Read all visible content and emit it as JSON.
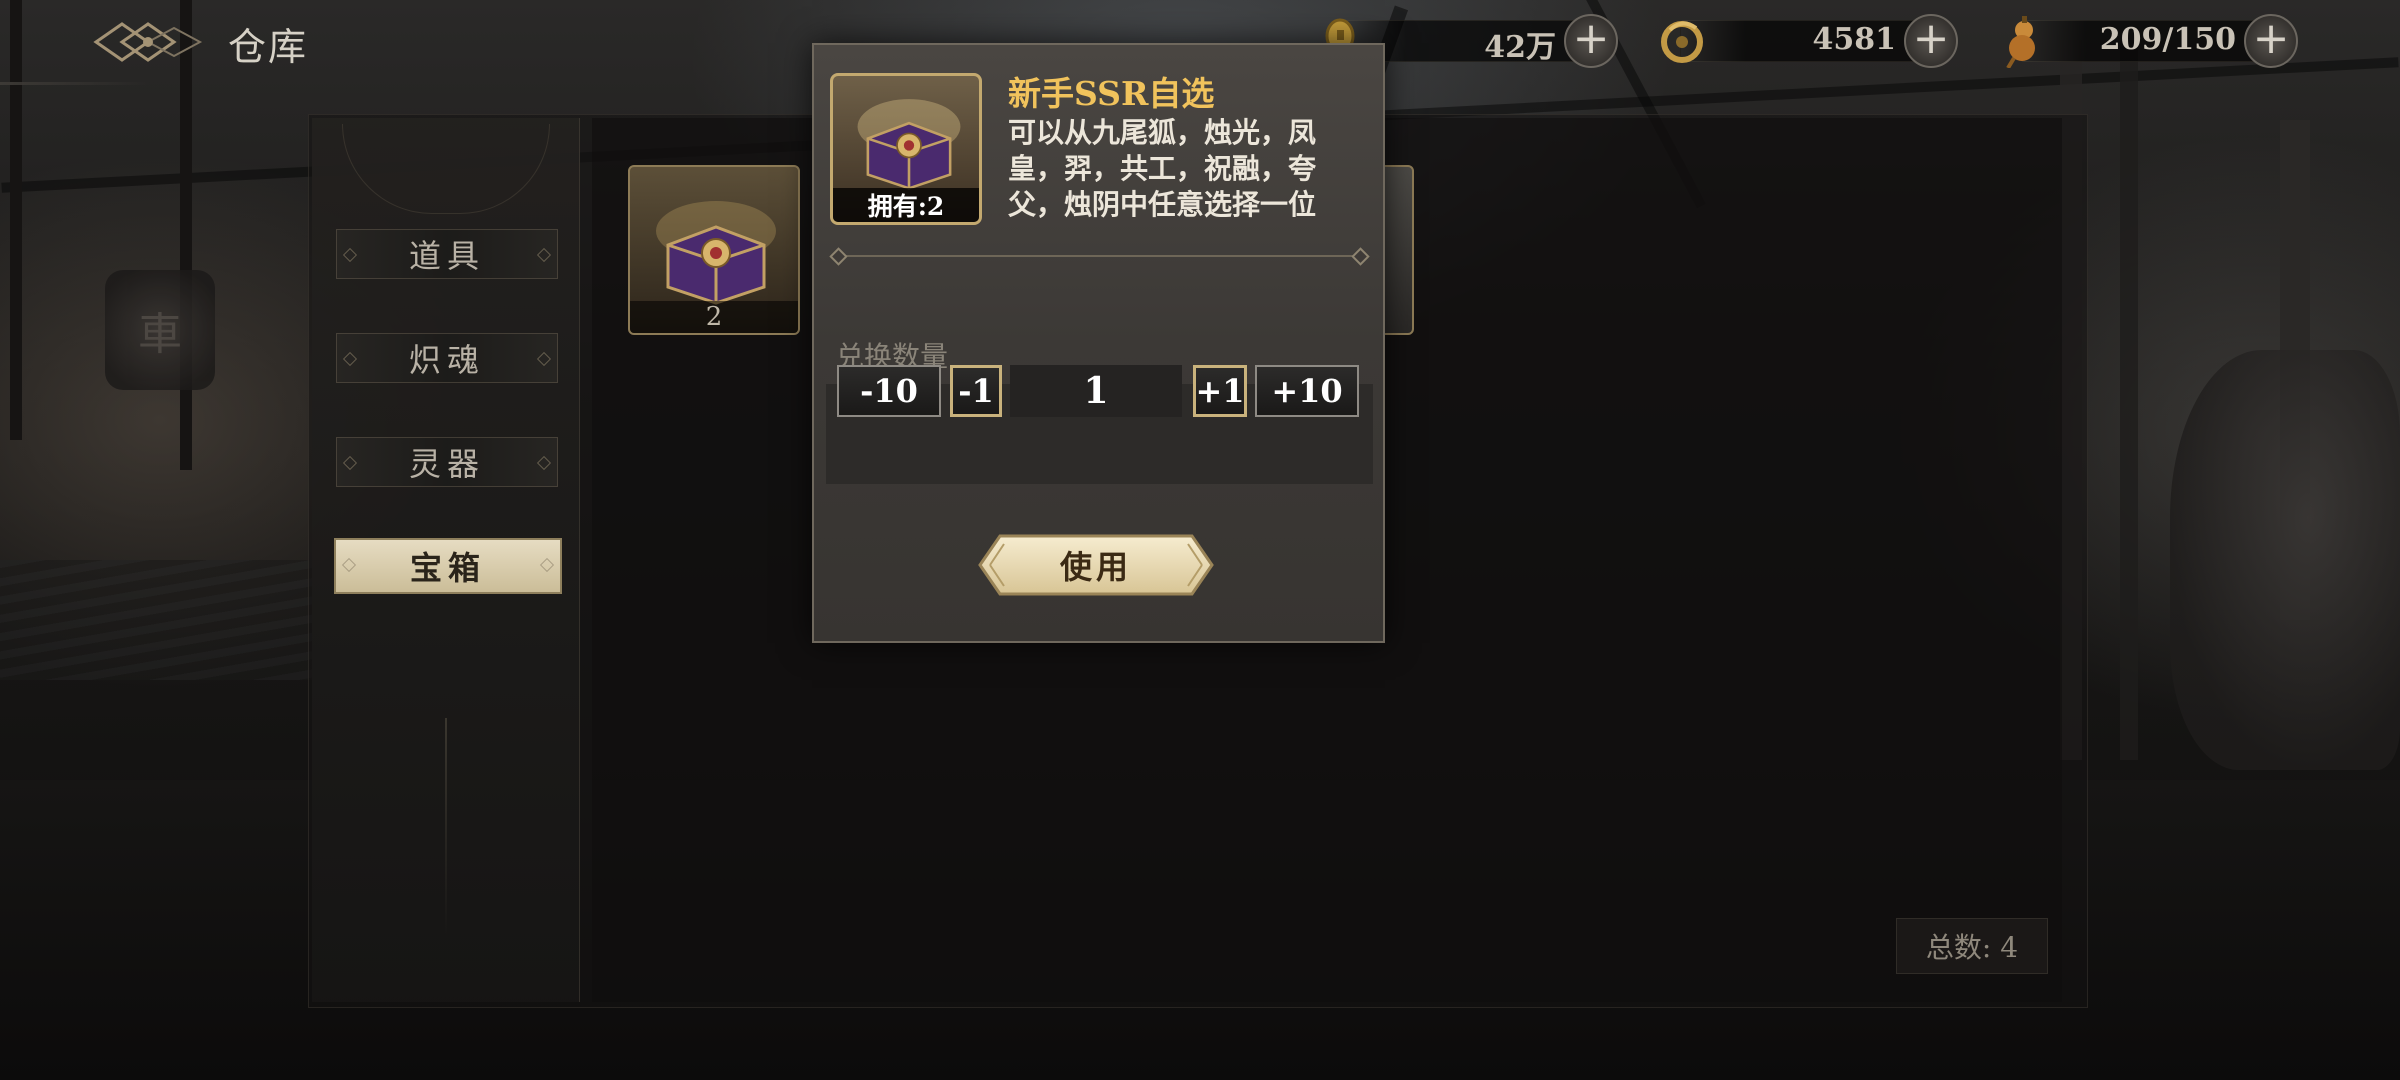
{
  "header": {
    "title": "仓库",
    "back_icon": "ornate-back-emblem-icon"
  },
  "resources": [
    {
      "name": "copper-coin",
      "icon": "coin-icon",
      "value": "42万"
    },
    {
      "name": "jade-dragon",
      "icon": "dragon-emblem-icon",
      "value": "4581"
    },
    {
      "name": "stamina-gourd",
      "icon": "gourd-icon",
      "value": "209/150"
    }
  ],
  "sidebar": {
    "tabs": [
      {
        "label": "道具",
        "active": false
      },
      {
        "label": "炽魂",
        "active": false
      },
      {
        "label": "灵器",
        "active": false
      },
      {
        "label": "宝箱",
        "active": true
      }
    ]
  },
  "inventory": {
    "items": [
      {
        "name": "新手SSR自选",
        "count": "2"
      }
    ],
    "total_label": "总数: 4"
  },
  "modal": {
    "item_name": "新手SSR自选",
    "owned_label": "拥有:2",
    "description": "可以从九尾狐，烛光，凤皇，羿，共工，祝融，夸父，烛阴中任意选择一位",
    "qty_label": "兑换数量",
    "btn_minus10": "-10",
    "btn_minus1": "-1",
    "qty_value": "1",
    "btn_plus1": "+1",
    "btn_plus10": "+10",
    "use_label": "使用"
  },
  "colors": {
    "gold_title": "#f1c35c",
    "active_tab": "#e6dcc2",
    "chest_purple": "#4a2a6e"
  }
}
